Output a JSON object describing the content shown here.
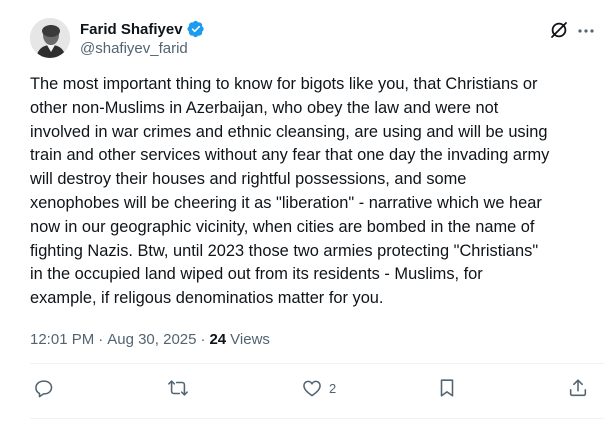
{
  "author": {
    "display_name": "Farid Shafiyev",
    "handle": "@shafiyev_farid",
    "verified": true
  },
  "tweet": {
    "text": "The most important thing to know for bigots like you, that Christians or\nother non-Muslims in Azerbaijan, who obey the law and were not\ninvolved in war crimes and ethnic cleansing, are using and will be using\ntrain and other services without any fear that one day the invading army\nwill destroy their houses and rightful possessions, and some\nxenophobes will be cheering it as \"liberation\" - narrative which we hear\nnow in our geographic vicinity, when cities are bombed in the name of\nfighting Nazis. Btw, until 2023 those two armies protecting \"Christians\"\nin the occupied land wiped out from its residents - Muslims, for\nexample, if religous denominatios matter for you."
  },
  "meta": {
    "time": "12:01 PM",
    "separator": "·",
    "date": "Aug 30, 2025",
    "views_count": "24",
    "views_label": "Views"
  },
  "actions": {
    "reply_icon": "reply-icon",
    "repost_icon": "repost-icon",
    "like_icon": "like-icon",
    "like_count": "2",
    "bookmark_icon": "bookmark-icon",
    "share_icon": "share-icon"
  },
  "colors": {
    "text": "#0f1419",
    "secondary": "#536471",
    "verified": "#1d9bf0",
    "divider": "#eff3f4"
  }
}
